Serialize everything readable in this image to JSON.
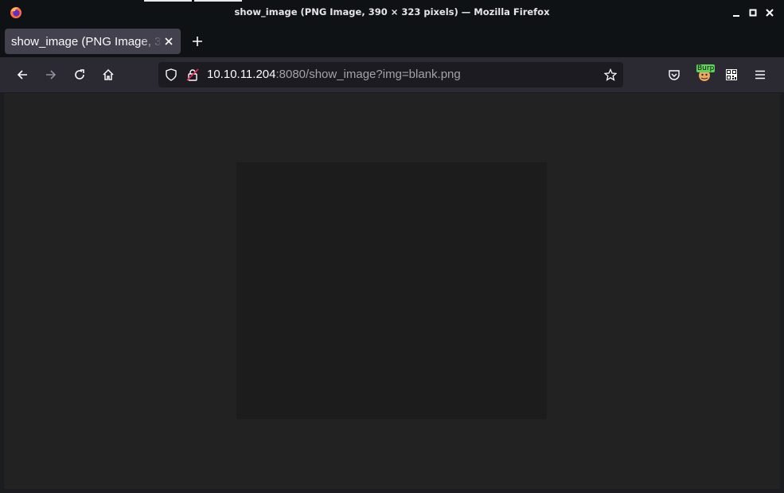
{
  "window": {
    "title": "show_image (PNG Image, 390 × 323 pixels) — Mozilla Firefox",
    "app_icon": "firefox-icon"
  },
  "window_controls": {
    "minimize_icon": "minimize-icon",
    "maximize_icon": "maximize-icon",
    "close_icon": "close-icon"
  },
  "tabs": [
    {
      "label": "show_image (PNG Image, 390 × 323 pixels)",
      "close_icon": "close-icon",
      "active": true
    }
  ],
  "new_tab_icon": "plus-icon",
  "navbar": {
    "back_icon": "arrow-left-icon",
    "forward_icon": "arrow-right-icon",
    "reload_icon": "reload-icon",
    "home_icon": "home-icon",
    "url": {
      "host": "10.10.11.204",
      "rest": ":8080/show_image?img=blank.png"
    },
    "tracking_protection_icon": "shield-icon",
    "insecure_icon": "lock-insecure-icon",
    "bookmark_icon": "star-icon",
    "pocket_icon": "pocket-icon",
    "extension_burp": {
      "label": "Burp",
      "icon": "burp-extension-icon"
    },
    "qr_icon": "qr-code-icon",
    "menu_icon": "hamburger-menu-icon"
  },
  "colors": {
    "chrome_dark": "#0f1215",
    "navbar": "#2b2a33",
    "url_field": "#1c1b22",
    "content_bg": "#222222",
    "image_bg": "#1c1c1c",
    "burp_green": "#5fd35a"
  },
  "image": {
    "filename": "blank.png"
  }
}
